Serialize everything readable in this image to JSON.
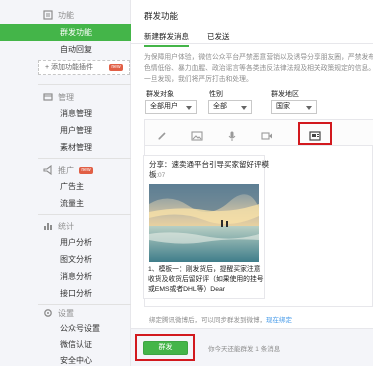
{
  "sidebar": {
    "groups": [
      {
        "title": "功能",
        "icon": "feature-icon",
        "items": [
          {
            "label": "群发功能",
            "active": true
          },
          {
            "label": "自动回复",
            "active": false
          }
        ]
      },
      {
        "title": "管理",
        "icon": "manage-icon",
        "items": [
          {
            "label": "消息管理"
          },
          {
            "label": "用户管理"
          },
          {
            "label": "素材管理"
          }
        ]
      },
      {
        "title": "推广",
        "icon": "promote-icon",
        "badge": "new",
        "items": [
          {
            "label": "广告主"
          },
          {
            "label": "流量主"
          }
        ]
      },
      {
        "title": "统计",
        "icon": "stats-icon",
        "items": [
          {
            "label": "用户分析"
          },
          {
            "label": "图文分析"
          },
          {
            "label": "消息分析"
          },
          {
            "label": "接口分析"
          }
        ]
      },
      {
        "title": "设置",
        "icon": "settings-icon",
        "items": [
          {
            "label": "公众号设置"
          },
          {
            "label": "微信认证"
          },
          {
            "label": "安全中心"
          }
        ]
      }
    ],
    "add_plugin": "+ 添加功能插件",
    "plugin_badge": "new"
  },
  "main": {
    "title": "群发功能",
    "tabs": [
      {
        "label": "新建群发消息",
        "active": true
      },
      {
        "label": "已发送",
        "active": false
      }
    ],
    "notice": "为保障用户体验，微信公众平台严禁恶意营销以及诱导分享朋友圈，严禁发布色情低俗、暴力血腥、政治谣言等各类违反法律法规及相关政策规定的信息。一旦发现，我们将严厉打击和处理。",
    "filters": [
      {
        "label": "群发对象",
        "value": "全部用户"
      },
      {
        "label": "性别",
        "value": "全部"
      },
      {
        "label": "群发地区",
        "value": "国家"
      }
    ],
    "toolbar": [
      "pencil-icon",
      "image-icon",
      "voice-icon",
      "video-icon",
      "news-icon"
    ],
    "card": {
      "title": "分享：速卖通平台引导买家留好评模板",
      "time": "13:07",
      "desc": "1、模板一：刚发货后，提醒买家注意收货及收货后留好评（如果使用的挂号或EMS或者DHL等）Dear"
    },
    "bind_hint": "绑定腾讯微博后，可以同步群发到微博",
    "bind_link": "现在绑定",
    "send_button": "群发",
    "quota": "你今天还能群发 1 条消息"
  },
  "colors": {
    "accent": "#44b549",
    "highlight": "#d2191e",
    "link": "#459ae9"
  }
}
